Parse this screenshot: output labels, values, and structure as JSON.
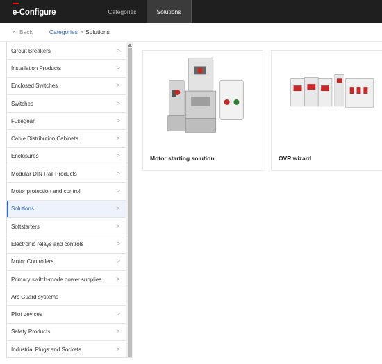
{
  "header": {
    "brand": "e-Configure",
    "tabs": [
      {
        "label": "Categories",
        "active": false
      },
      {
        "label": "Solutions",
        "active": true
      }
    ],
    "accent_color": "#ff000f"
  },
  "breadcrumb": {
    "back_label": "Back",
    "link": "Categories",
    "separator": ">",
    "current": "Solutions"
  },
  "sidebar": {
    "items": [
      {
        "label": "Circuit Breakers",
        "chevron": true
      },
      {
        "label": "Installation Products",
        "chevron": true
      },
      {
        "label": "Enclosed Switches",
        "chevron": true
      },
      {
        "label": "Switches",
        "chevron": true
      },
      {
        "label": "Fusegear",
        "chevron": true
      },
      {
        "label": "Cable Distribution Cabinets",
        "chevron": true
      },
      {
        "label": "Enclosures",
        "chevron": true
      },
      {
        "label": "Modular DIN Rail Products",
        "chevron": true
      },
      {
        "label": "Motor protection and control",
        "chevron": true
      },
      {
        "label": "Solutions",
        "chevron": true,
        "active": true
      },
      {
        "label": "Softstarters",
        "chevron": true
      },
      {
        "label": "Electronic relays and controls",
        "chevron": true
      },
      {
        "label": "Motor Controllers",
        "chevron": true
      },
      {
        "label": "Primary switch-mode power supplies",
        "chevron": true
      },
      {
        "label": "Arc Guard systems",
        "chevron": false
      },
      {
        "label": "Pilot devices",
        "chevron": true
      },
      {
        "label": "Safety Products",
        "chevron": true
      },
      {
        "label": "Industrial Plugs and Sockets",
        "chevron": true
      }
    ]
  },
  "cards": [
    {
      "title": "Motor starting solution",
      "icon": "motor-starter-product-image"
    },
    {
      "title": "OVR wizard",
      "icon": "surge-protector-product-image"
    }
  ]
}
